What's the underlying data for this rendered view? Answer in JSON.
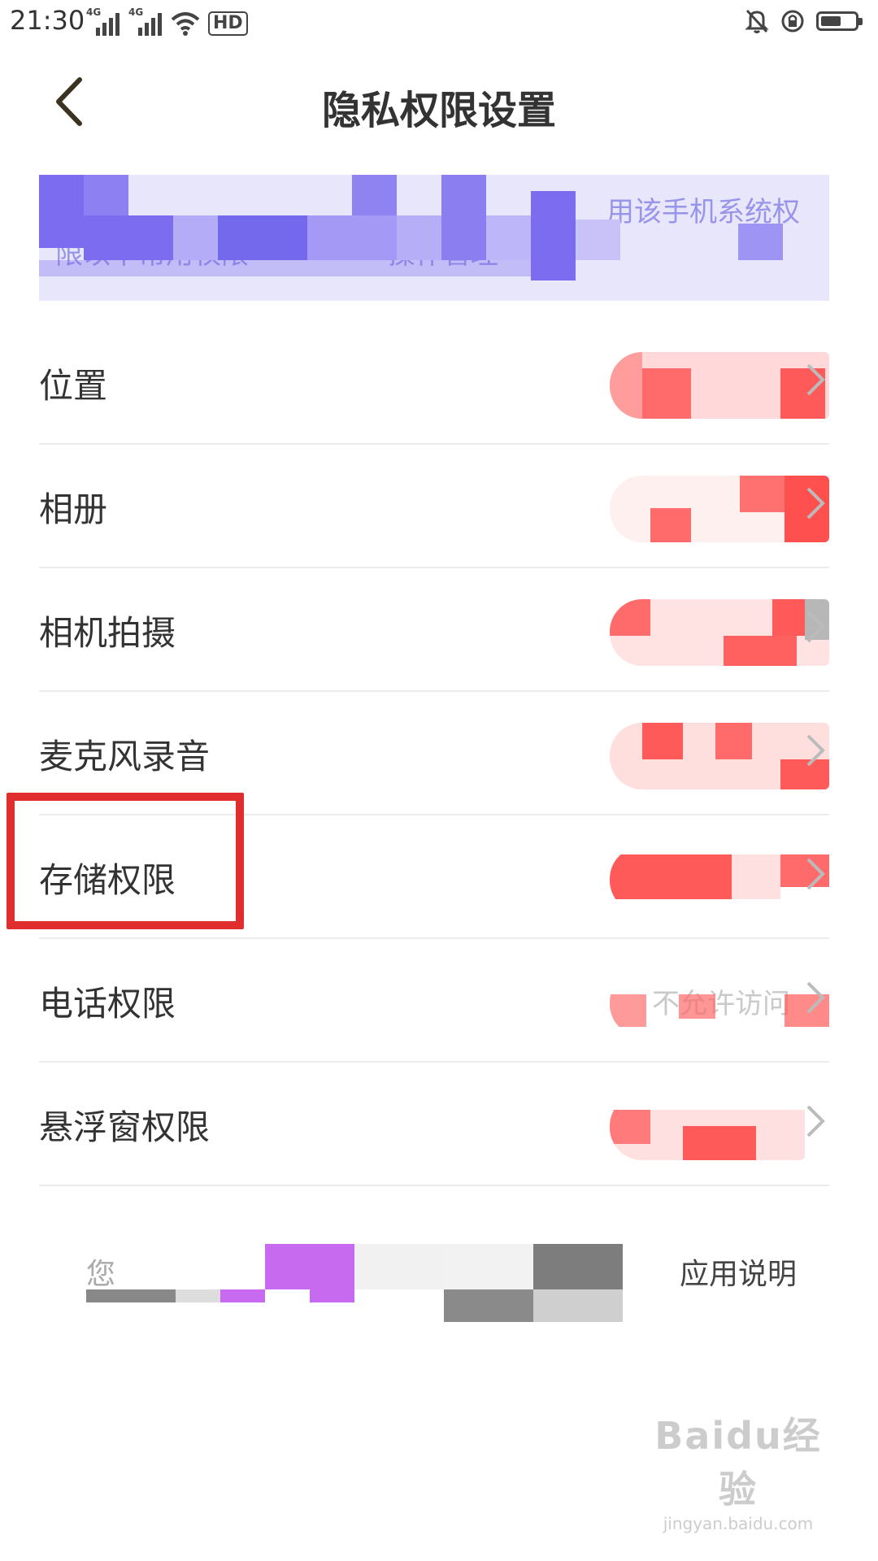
{
  "status_bar": {
    "time": "21:30",
    "network_a": "4G",
    "network_b": "4G",
    "hd_label": "HD",
    "icons": [
      "signal-icon",
      "signal-icon",
      "wifi-icon",
      "hd-icon",
      "mute-icon",
      "rotation-lock-icon",
      "battery-icon"
    ],
    "battery_level": 0.5
  },
  "header": {
    "back_icon": "chevron-left-icon",
    "title": "隐私权限设置"
  },
  "notice": {
    "visible_fragment_1": "用该手机系统权",
    "visible_fragment_2": "限以下常用权限",
    "visible_fragment_3": "操作管理"
  },
  "permissions": [
    {
      "label": "位置",
      "value": ""
    },
    {
      "label": "相册",
      "value": ""
    },
    {
      "label": "相机拍摄",
      "value": ""
    },
    {
      "label": "麦克风录音",
      "value": ""
    },
    {
      "label": "存储权限",
      "value": "",
      "highlighted": true
    },
    {
      "label": "电话权限",
      "value": "不允许访问"
    },
    {
      "label": "悬浮窗权限",
      "value": ""
    }
  ],
  "footer": {
    "lead": "您",
    "tail": "应用说明"
  },
  "watermark": {
    "brand": "Baidu经验",
    "site": "jingyan.baidu.com"
  },
  "colors": {
    "highlight": "#e02d2d",
    "mosaic_purple": "#7b6cf0",
    "mosaic_red": "#ff6a6a"
  }
}
